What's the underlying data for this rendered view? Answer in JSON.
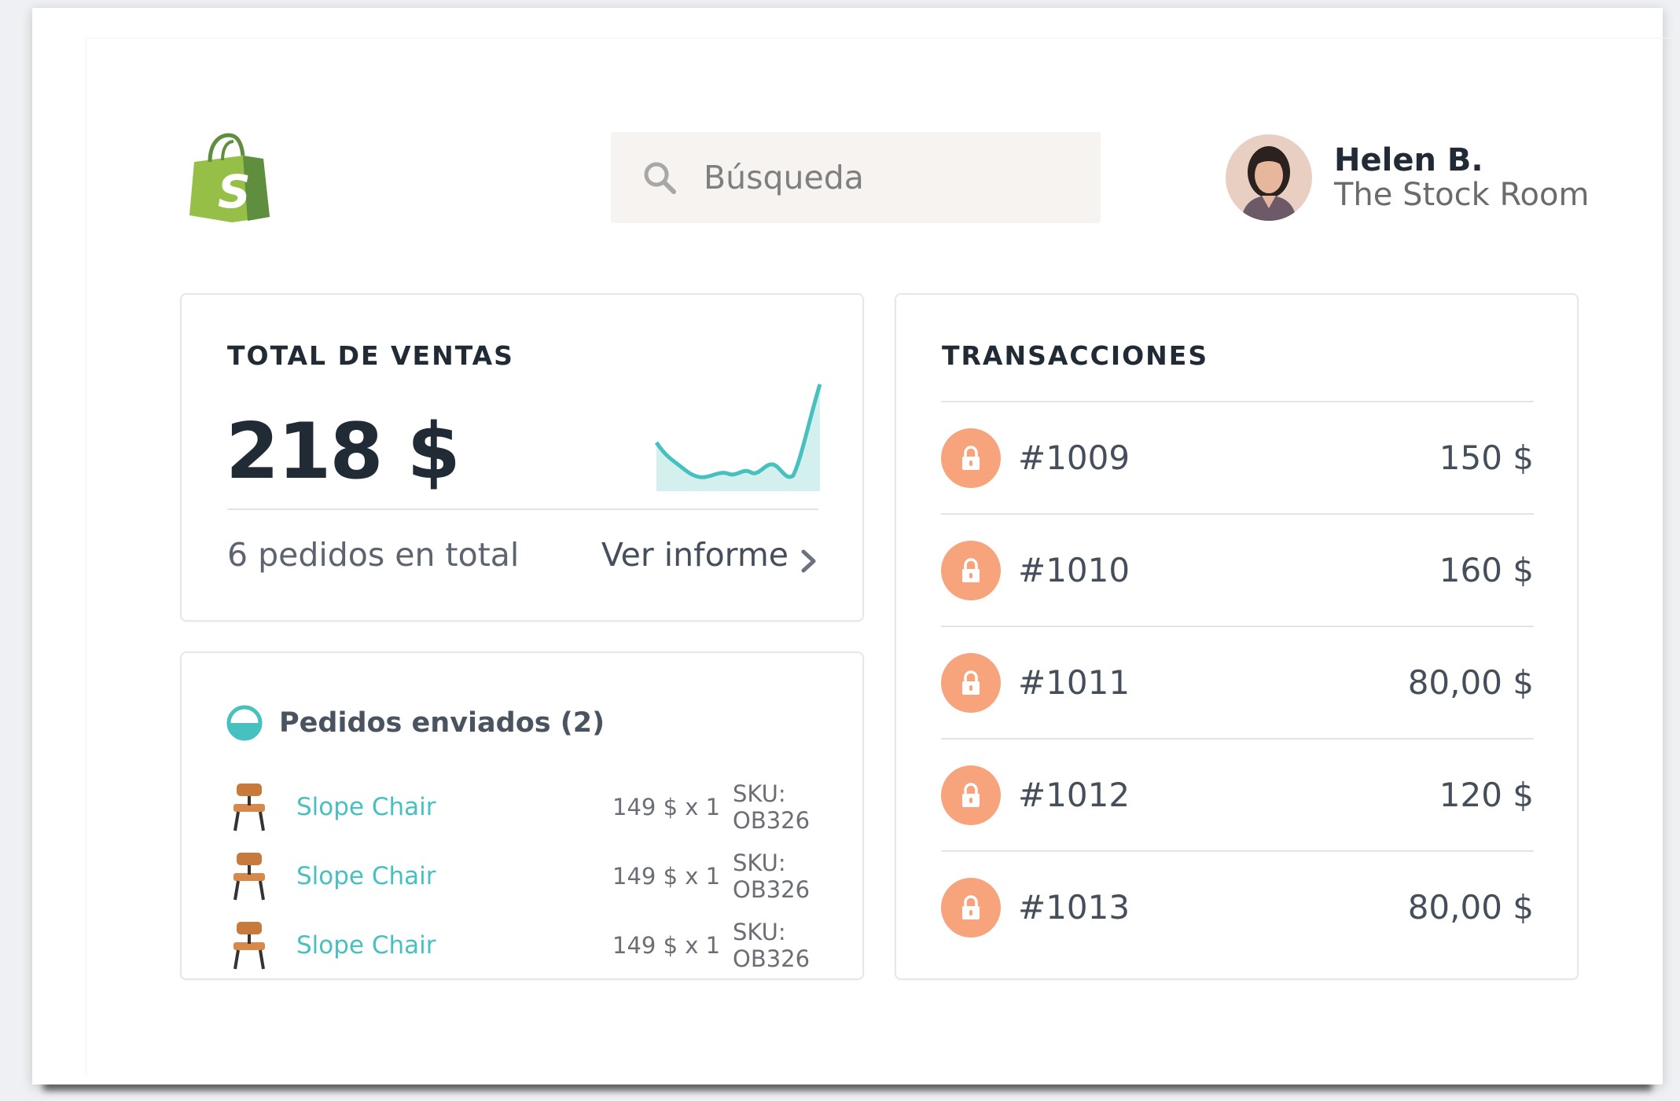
{
  "header": {
    "logo_icon": "shopify-bag-icon",
    "search": {
      "placeholder": "Búsqueda",
      "icon": "search-icon"
    },
    "user": {
      "name": "Helen B.",
      "store": "The Stock Room"
    }
  },
  "sales": {
    "title": "TOTAL DE VENTAS",
    "total": "218 $",
    "orders_text": "6 pedidos en total",
    "report_link": "Ver informe",
    "sparkline_color": "#47c1bf"
  },
  "shipped": {
    "title": "Pedidos enviados (2)",
    "status_color": "#47c1bf",
    "items": [
      {
        "name": "Slope Chair",
        "qty": "149 $ x 1",
        "sku": "SKU: OB326"
      },
      {
        "name": "Slope Chair",
        "qty": "149 $ x 1",
        "sku": "SKU: OB326"
      },
      {
        "name": "Slope Chair",
        "qty": "149 $ x 1",
        "sku": "SKU: OB326"
      }
    ]
  },
  "transactions": {
    "title": "TRANSACCIONES",
    "icon": "lock-icon",
    "icon_color": "#f7a47c",
    "rows": [
      {
        "id": "#1009",
        "amount": "150 $"
      },
      {
        "id": "#1010",
        "amount": "160 $"
      },
      {
        "id": "#1011",
        "amount": "80,00 $"
      },
      {
        "id": "#1012",
        "amount": "120 $"
      },
      {
        "id": "#1013",
        "amount": "80,00 $"
      }
    ]
  }
}
